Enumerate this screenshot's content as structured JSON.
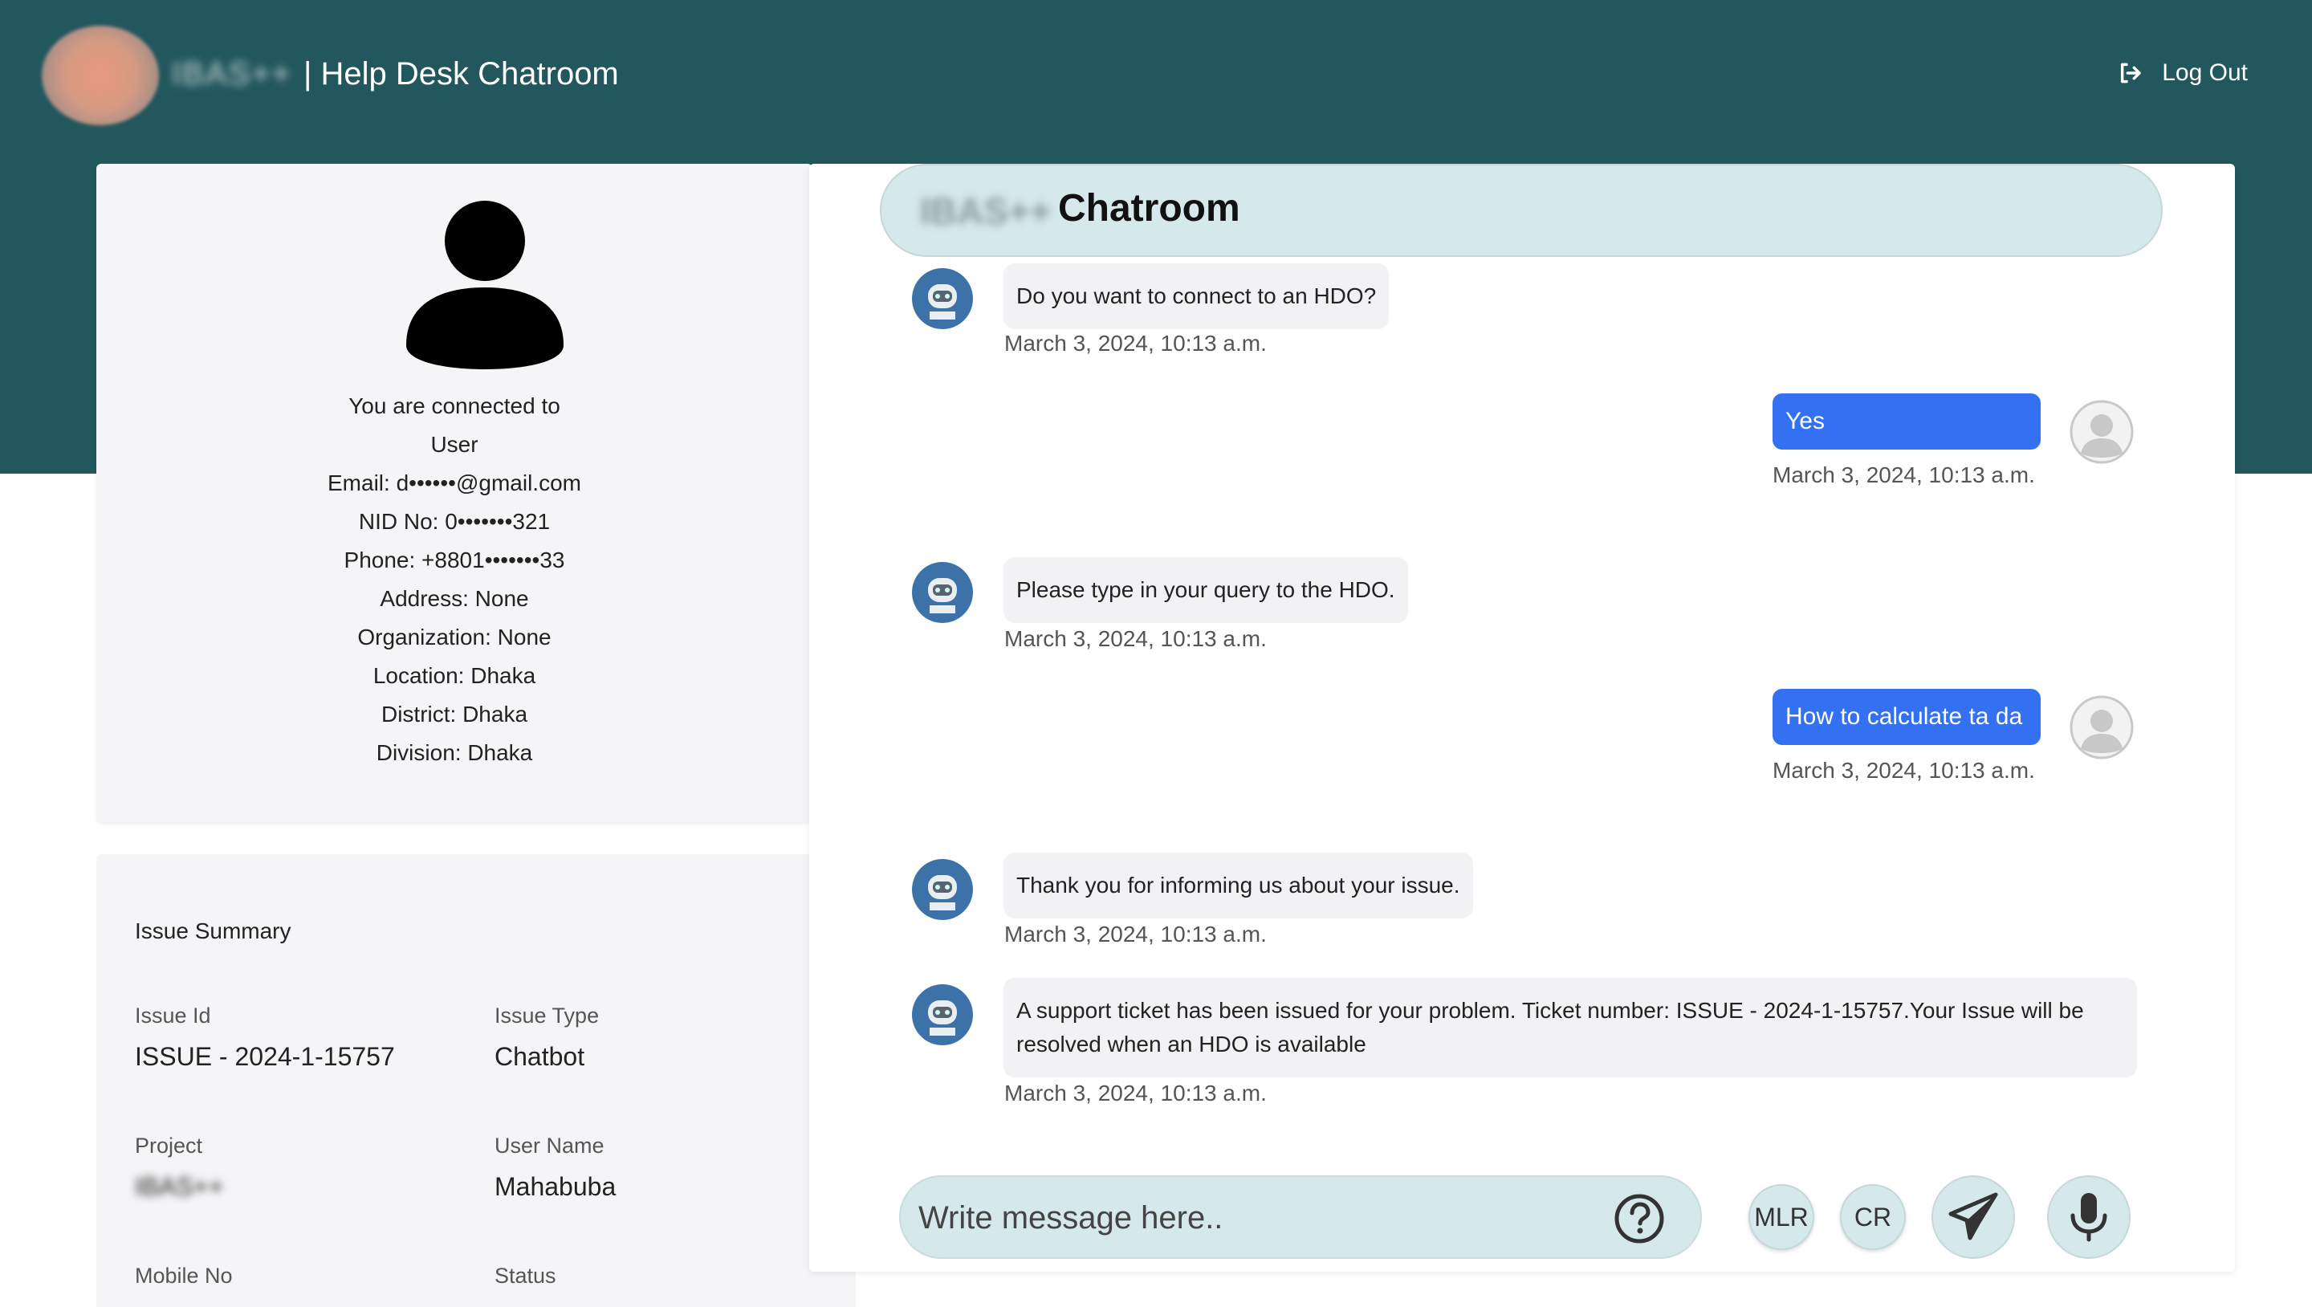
{
  "header": {
    "brand_name": "IBAS++",
    "title": "| Help Desk Chatroom",
    "logout_label": "Log Out"
  },
  "connection": {
    "line1": "You are connected to",
    "line2": "User",
    "email": "Email: d••••••@gmail.com",
    "nid": "NID No: 0•••••••321",
    "phone": "Phone: +8801•••••••33",
    "address": "Address: None",
    "organization": "Organization: None",
    "location": "Location: Dhaka",
    "district": "District: Dhaka",
    "division": "Division: Dhaka"
  },
  "issue": {
    "title": "Issue Summary",
    "issue_id_label": "Issue Id",
    "issue_id": "ISSUE - 2024-1-15757",
    "issue_type_label": "Issue Type",
    "issue_type": "Chatbot",
    "project_label": "Project",
    "project": "IBAS++",
    "username_label": "User Name",
    "username": "Mahabuba",
    "mobile_label": "Mobile No",
    "status_label": "Status"
  },
  "chat": {
    "brand": "IBAS++",
    "title": "Chatroom",
    "messages": [
      {
        "from": "bot",
        "text": "Do you want to connect to an HDO?",
        "time": "March 3, 2024, 10:13 a.m."
      },
      {
        "from": "user",
        "text": "Yes",
        "time": "March 3, 2024, 10:13 a.m."
      },
      {
        "from": "bot",
        "text": "Please type in your query to the HDO.",
        "time": "March 3, 2024, 10:13 a.m."
      },
      {
        "from": "user",
        "text": "How to calculate ta da",
        "time": "March 3, 2024, 10:13 a.m."
      },
      {
        "from": "bot",
        "text": "Thank you for informing us about your issue.",
        "time": "March 3, 2024, 10:13 a.m."
      },
      {
        "from": "bot",
        "text": "A support ticket has been issued for your problem. Ticket number: ISSUE - 2024-1-15757.Your Issue will be resolved when an HDO is available",
        "time": "March 3, 2024, 10:13 a.m."
      }
    ]
  },
  "composer": {
    "placeholder": "Write message here..",
    "mlr_label": "MLR",
    "cr_label": "CR"
  },
  "icons": {
    "logout": "logout-icon",
    "help": "help-icon",
    "send": "send-icon",
    "mic": "mic-icon"
  },
  "colors": {
    "topbar": "#23575e",
    "user_bubble": "#3371f2",
    "accent_light": "#d5e8ea"
  }
}
